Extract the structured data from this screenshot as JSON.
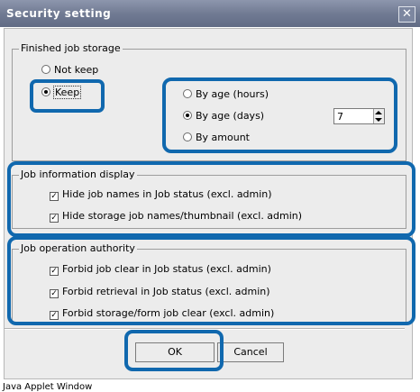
{
  "window": {
    "title": "Security setting",
    "close_glyph": "✕",
    "status_text": "Java Applet Window"
  },
  "finished_job_storage": {
    "label": "Finished job storage",
    "not_keep": "Not keep",
    "keep": "Keep",
    "by_age_hours": "By age (hours)",
    "by_age_days": "By age (days)",
    "by_amount": "By amount",
    "days_value": "7",
    "keep_selected": true,
    "age_days_selected": true
  },
  "job_info_display": {
    "label": "Job information display",
    "hide_job_names": "Hide job names in Job status (excl. admin)",
    "hide_storage_names": "Hide storage job names/thumbnail (excl. admin)"
  },
  "job_operation_authority": {
    "label": "Job operation authority",
    "forbid_clear": "Forbid job clear in Job status (excl. admin)",
    "forbid_retrieval": "Forbid retrieval in Job status (excl. admin)",
    "forbid_storage_clear": "Forbid storage/form job clear (excl. admin)"
  },
  "buttons": {
    "ok": "OK",
    "cancel": "Cancel"
  },
  "colors": {
    "highlight": "#1068ae",
    "titlebar": "#717b93",
    "dialog_bg": "#ececec"
  },
  "icons": {
    "close": "close-icon",
    "check": "checkmark-icon",
    "spin_up": "arrow-up-icon",
    "spin_down": "arrow-down-icon"
  }
}
